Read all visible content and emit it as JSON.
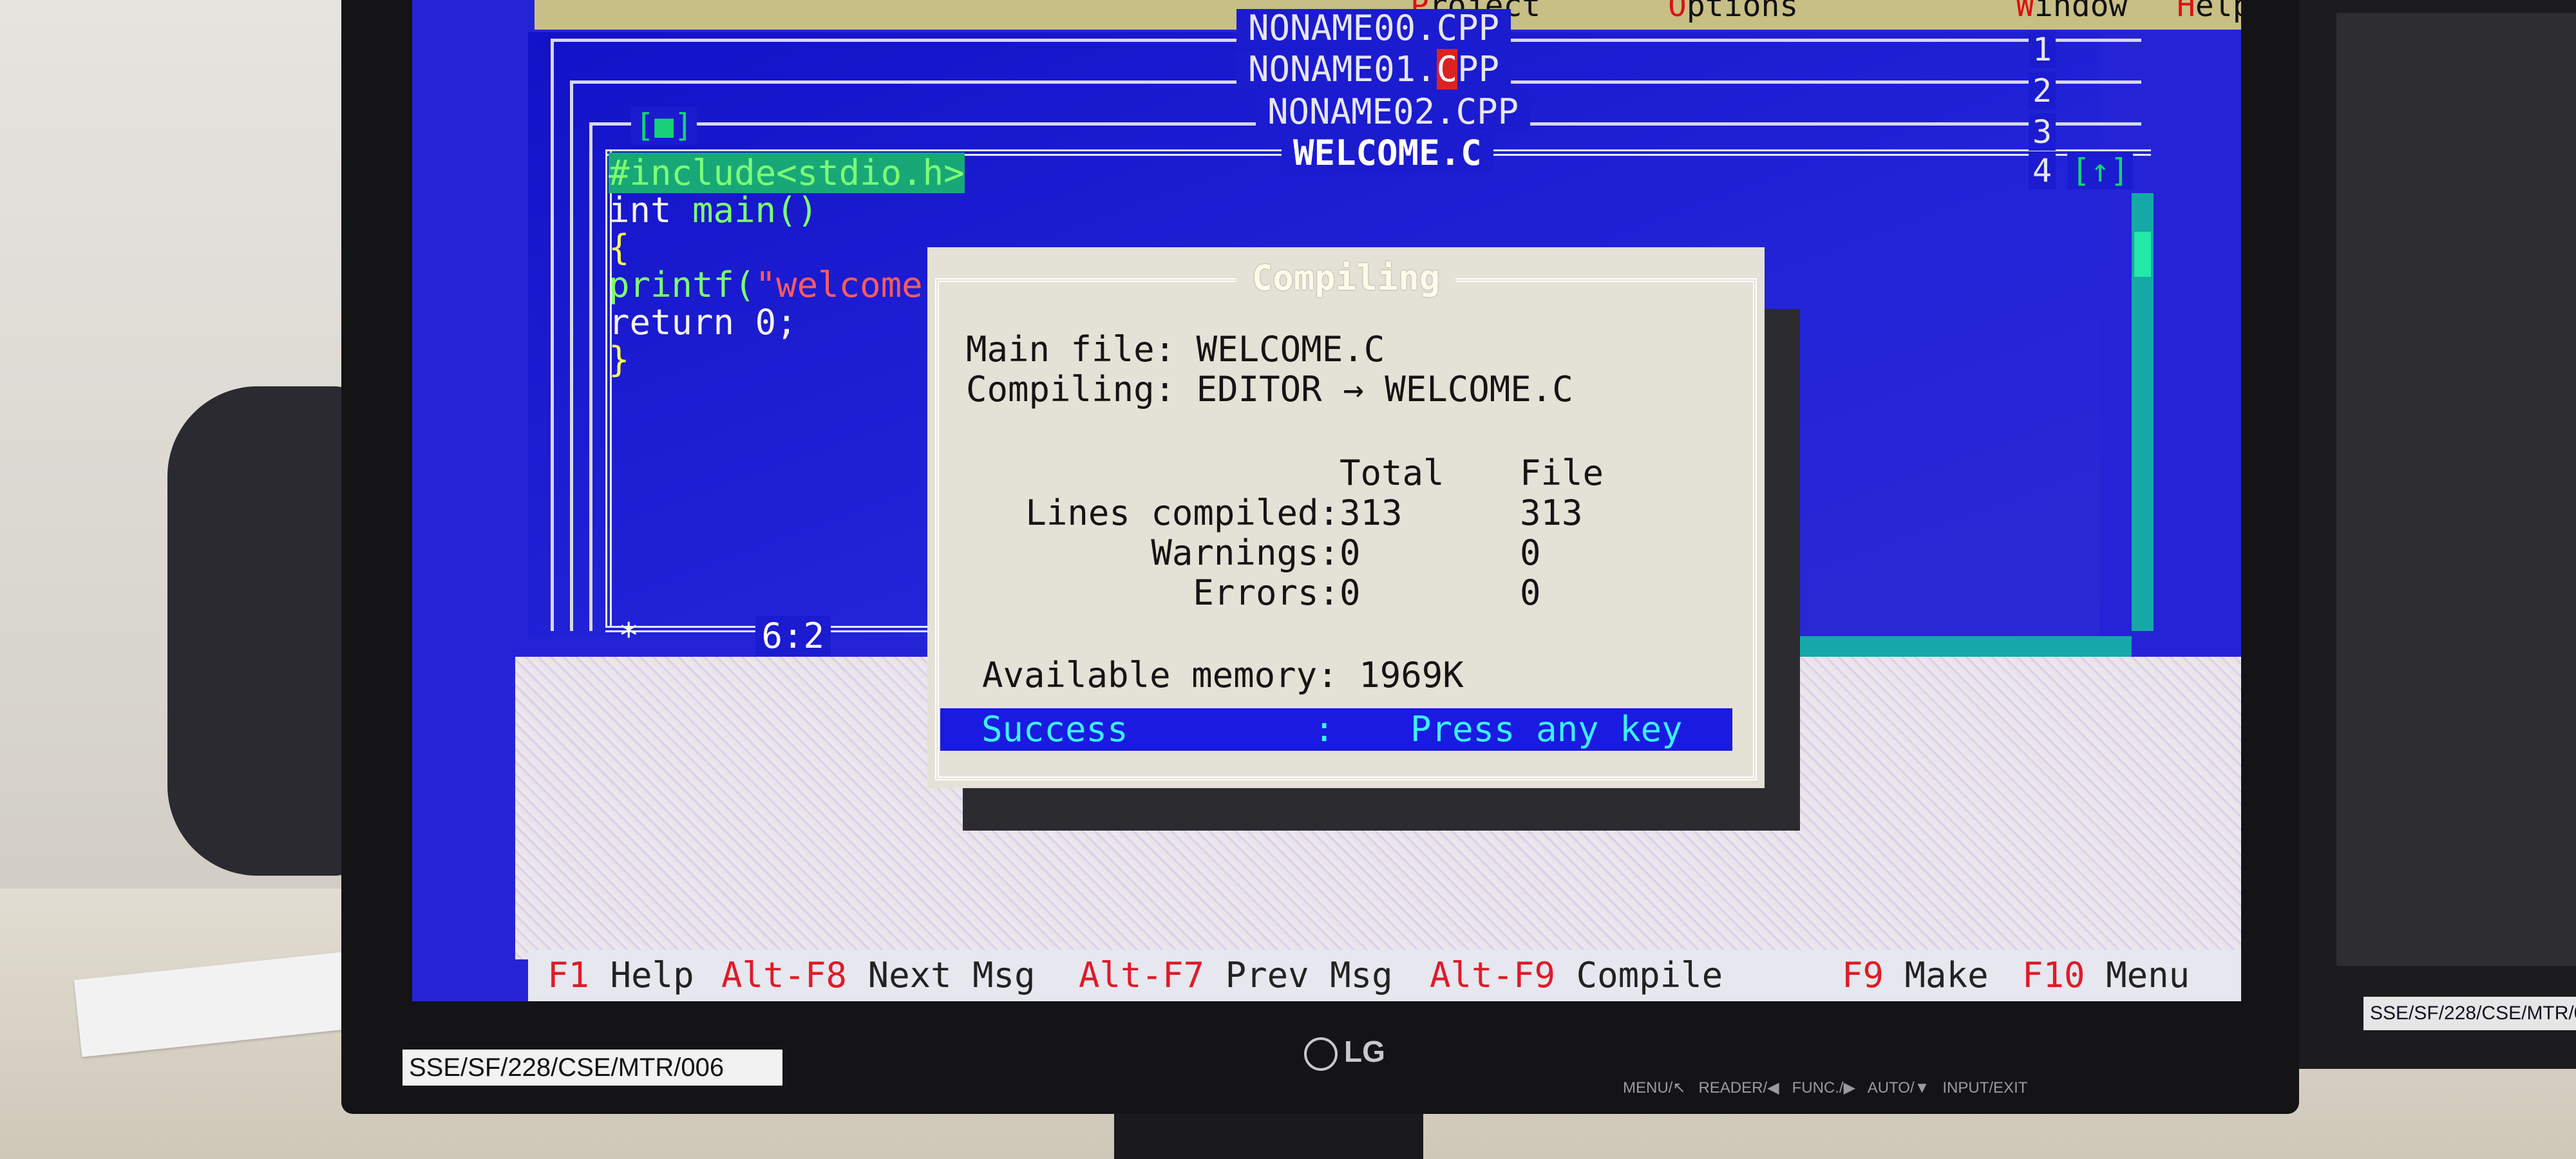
{
  "menu": {
    "items": [
      {
        "hot": "P",
        "rest": "roject"
      },
      {
        "hot": "O",
        "rest": "ptions"
      },
      {
        "hot": "W",
        "rest": "indow"
      },
      {
        "hot": "H",
        "rest": "elp"
      }
    ]
  },
  "windows": [
    {
      "title": "NONAME00.CPP",
      "number": "1"
    },
    {
      "title_pre": "NONAME01.",
      "title_cursor": "C",
      "title_post": "PP",
      "number": "2"
    },
    {
      "title": "NONAME02.CPP",
      "number": "3"
    },
    {
      "title": "WELCOME.C",
      "number": "4"
    }
  ],
  "editor": {
    "close_box": "[■]",
    "zoom_box": "[↑]",
    "code": {
      "line1": "#include<stdio.h>",
      "line2_kw": "int ",
      "line2_fn": "main()",
      "line3": "{",
      "line4_fn": "printf(",
      "line4_str": "\"welcome",
      "line5": "return 0;",
      "line6": "}"
    },
    "cursor_position": "6:2",
    "status_star": "*"
  },
  "dialog": {
    "title": "Compiling",
    "main_file_label": "Main file:",
    "main_file_value": "WELCOME.C",
    "compiling_label": "Compiling:",
    "compiling_value": "EDITOR → WELCOME.C",
    "col_total": "Total",
    "col_file": "File",
    "rows": [
      {
        "label": "Lines compiled:",
        "total": "313",
        "file": "313"
      },
      {
        "label": "Warnings:",
        "total": "0",
        "file": "0"
      },
      {
        "label": "Errors:",
        "total": "0",
        "file": "0"
      }
    ],
    "memory_label": "Available memory:",
    "memory_value": "1969K",
    "status": "Success",
    "status_sep": ":",
    "status_msg": "Press any key"
  },
  "helpbar": [
    {
      "key": "F1",
      "label": "Help"
    },
    {
      "key": "Alt-F8",
      "label": "Next Msg"
    },
    {
      "key": "Alt-F7",
      "label": "Prev Msg"
    },
    {
      "key": "Alt-F9",
      "label": "Compile"
    },
    {
      "key": "F9",
      "label": "Make"
    },
    {
      "key": "F10",
      "label": "Menu"
    }
  ],
  "monitor": {
    "brand": "LG",
    "asset_tag": "SSE/SF/228/CSE/MTR/006",
    "controls": "MENU/↖   READER/◀   FUNC./▶   AUTO/▼   INPUT/EXIT",
    "second_asset_tag": "SSE/SF/228/CSE/MTR/0"
  },
  "colors": {
    "editor_bg": "#2424d6",
    "dialog_bg": "#e4e1d6",
    "success_bar": "#1a1ae0",
    "hotkey_red": "#e01a28"
  }
}
